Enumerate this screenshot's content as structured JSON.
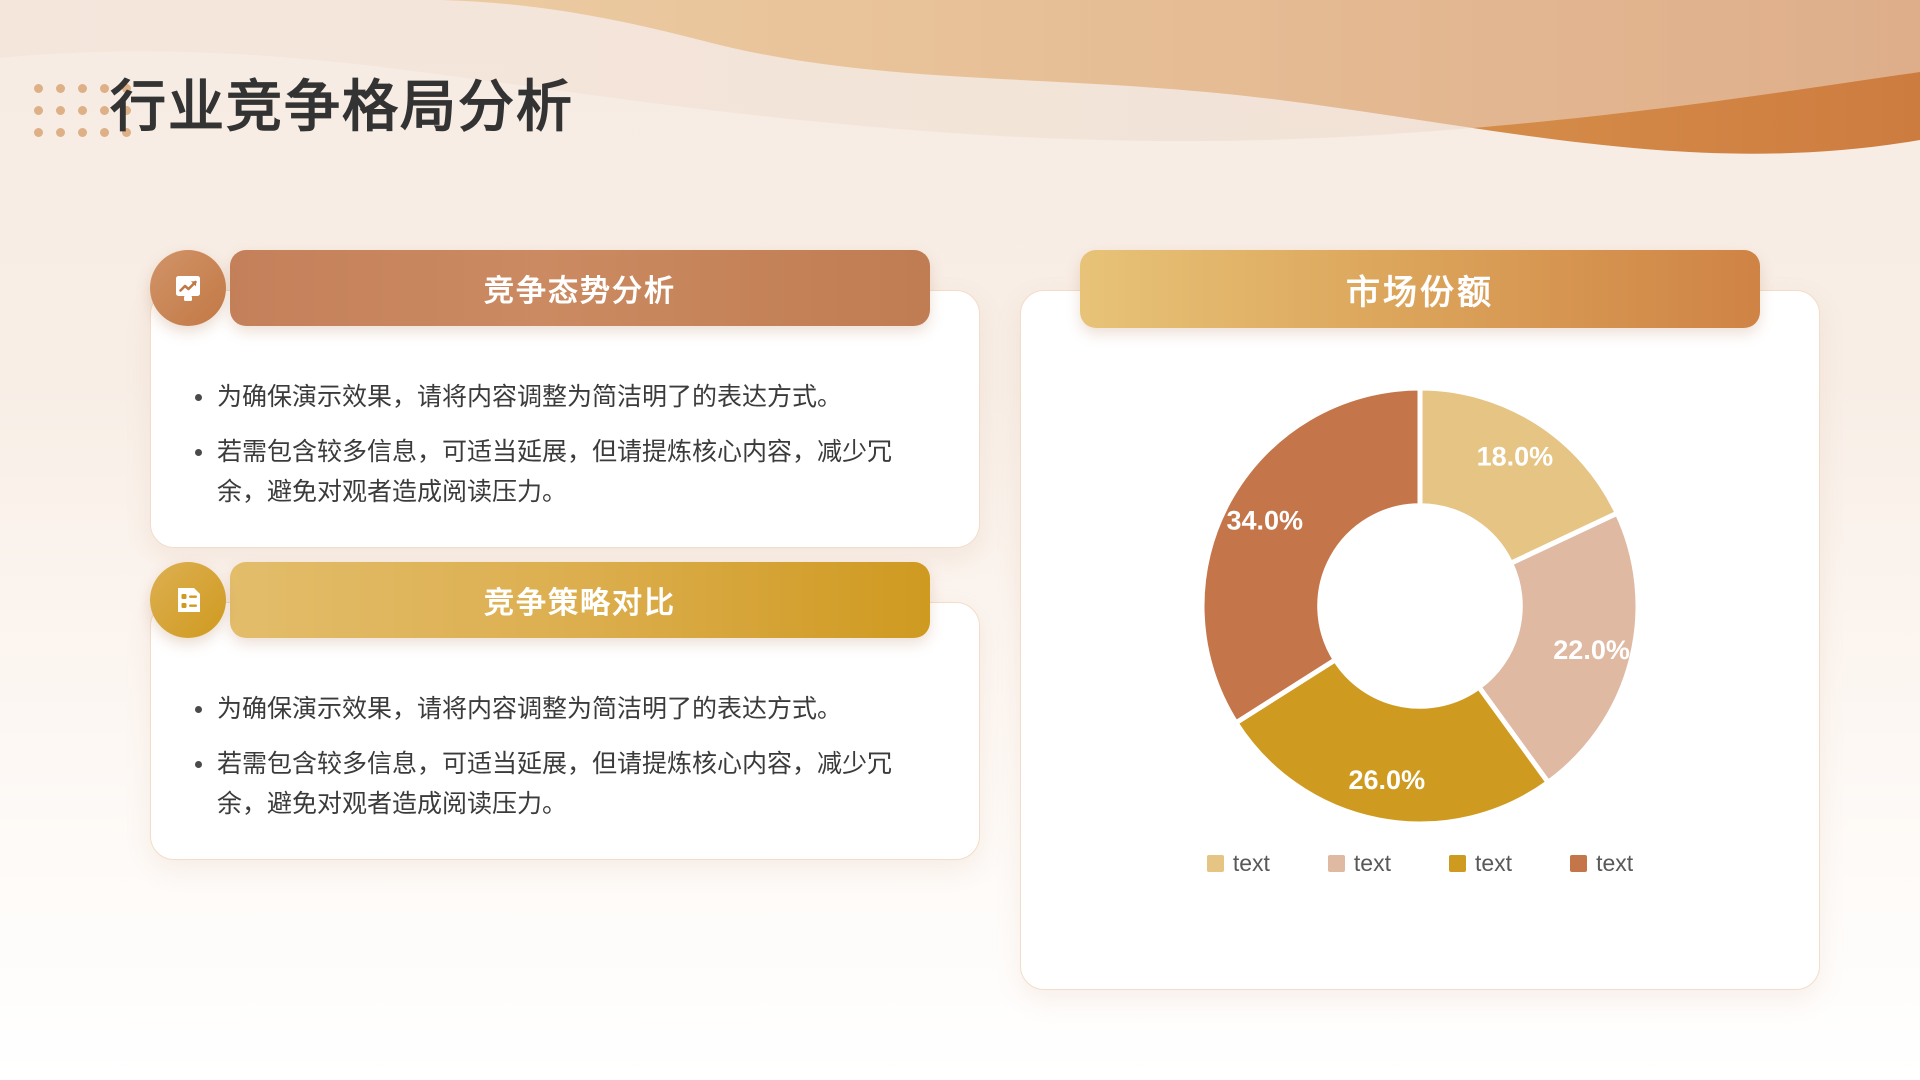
{
  "slide": {
    "title": "行业竞争格局分析",
    "background_color": "#f8eee6",
    "accent_color": "#cf8345",
    "gold_color": "#cf9a20"
  },
  "left_sections": [
    {
      "header": "竞争态势分析",
      "icon": "presentation-chart-icon",
      "header_color": "#c4805a",
      "bullets": [
        "为确保演示效果，请将内容调整为简洁明了的表达方式。",
        "若需包含较多信息，可适当延展，但请提炼核心内容，减少冗余，避免对观者造成阅读压力。"
      ]
    },
    {
      "header": "竞争策略对比",
      "icon": "document-list-icon",
      "header_color": "#cf9a20",
      "bullets": [
        "为确保演示效果，请将内容调整为简洁明了的表达方式。",
        "若需包含较多信息，可适当延展，但请提炼核心内容，减少冗余，避免对观者造成阅读压力。"
      ]
    }
  ],
  "chart_panel": {
    "header": "市场份额"
  },
  "chart_data": {
    "type": "pie",
    "title": "市场份额",
    "donut": true,
    "inner_radius_ratio": 0.46,
    "start_angle_deg": 0,
    "direction": "clockwise",
    "legend_position": "bottom",
    "categories": [
      "text",
      "text",
      "text",
      "text"
    ],
    "values": [
      18.0,
      22.0,
      26.0,
      34.0
    ],
    "labels": [
      "18.0%",
      "22.0%",
      "26.0%",
      "34.0%"
    ],
    "colors": [
      "#e5c484",
      "#dfb9a2",
      "#cf9a20",
      "#c4764a"
    ],
    "legend_entries": [
      {
        "label": "text",
        "color": "#e5c484"
      },
      {
        "label": "text",
        "color": "#dfb9a2"
      },
      {
        "label": "text",
        "color": "#cf9a20"
      },
      {
        "label": "text",
        "color": "#c4764a"
      }
    ],
    "xlabel": "",
    "ylabel": ""
  }
}
